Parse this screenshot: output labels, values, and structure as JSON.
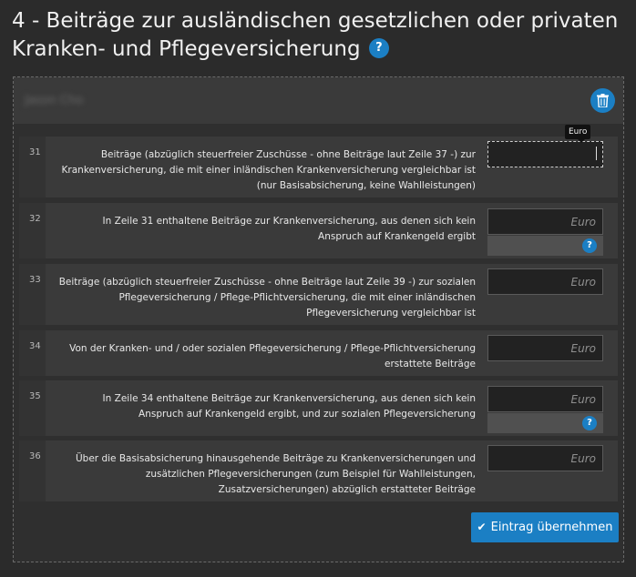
{
  "page": {
    "title": "4 - Beiträge zur ausländischen gesetzlichen oder privaten Kranken- und Pflegeversicherung",
    "help_glyph": "?"
  },
  "panel": {
    "person_name": "Jason Cho",
    "delete_icon": "trash-icon"
  },
  "tooltip": "Euro",
  "rows": [
    {
      "number": "31",
      "label": "Beiträge (abzüglich steuerfreier Zuschüsse - ohne Beiträge laut Zeile 37 -) zur Krankenversicherung, die mit einer inländischen Krankenversicherung vergleichbar ist (nur Basisabsicherung, keine Wahlleistungen)",
      "value": "",
      "placeholder": "Euro"
    },
    {
      "number": "32",
      "label": "In Zeile 31 enthaltene Beiträge zur Krankenversicherung, aus denen sich kein Anspruch auf Krankengeld ergibt",
      "value": "",
      "placeholder": "Euro",
      "help": "?"
    },
    {
      "number": "33",
      "label": "Beiträge (abzüglich steuerfreier Zuschüsse - ohne Beiträge laut Zeile 39 -) zur sozialen Pflegeversicherung / Pflege-Pflichtversicherung, die mit einer inländischen Pflegeversicherung vergleichbar ist",
      "value": "",
      "placeholder": "Euro"
    },
    {
      "number": "34",
      "label": "Von der Kranken- und / oder sozialen Pflegeversicherung / Pflege-Pflichtversicherung erstattete Beiträge",
      "value": "",
      "placeholder": "Euro"
    },
    {
      "number": "35",
      "label": "In Zeile 34 enthaltene Beiträge zur Krankenversicherung, aus denen sich kein Anspruch auf Krankengeld ergibt, und zur sozialen Pflegeversicherung",
      "value": "",
      "placeholder": "Euro",
      "help": "?"
    },
    {
      "number": "36",
      "label": "Über die Basisabsicherung hinausgehende Beiträge zu Krankenversicherungen und zusätzlichen Pflegeversicherungen (zum Beispiel für Wahlleistungen, Zusatzversicherungen) abzüglich erstatteter Beiträge",
      "value": "",
      "placeholder": "Euro"
    }
  ],
  "submit": {
    "label": "Eintrag übernehmen",
    "icon": "check-icon"
  },
  "colors": {
    "accent": "#1b7fc4",
    "background": "#2b2b2b",
    "row_background": "#3a3a3a"
  }
}
